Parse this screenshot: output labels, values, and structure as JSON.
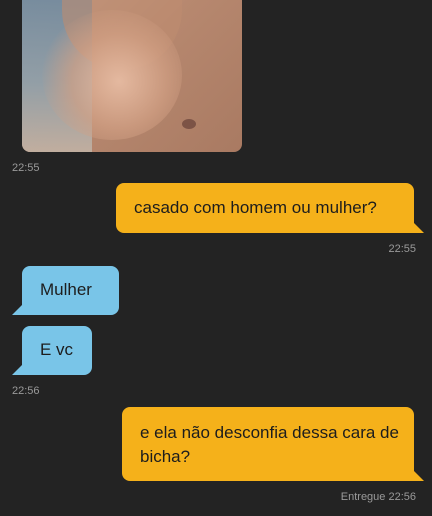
{
  "photo_message": {
    "icon": "received-photo",
    "time": "22:55"
  },
  "messages": [
    {
      "direction": "sent",
      "text": "casado com homem ou mulher?",
      "time": "22:55"
    },
    {
      "direction": "received",
      "text": "Mulher"
    },
    {
      "direction": "received",
      "text": "E vc",
      "time": "22:56"
    },
    {
      "direction": "sent",
      "text": "e ela não desconfia dessa cara de bicha?",
      "status": "Entregue 22:56"
    }
  ],
  "colors": {
    "background": "#232323",
    "sent_bubble": "#f5b11a",
    "received_bubble": "#79c5e8",
    "timestamp": "#9a9a9a"
  }
}
